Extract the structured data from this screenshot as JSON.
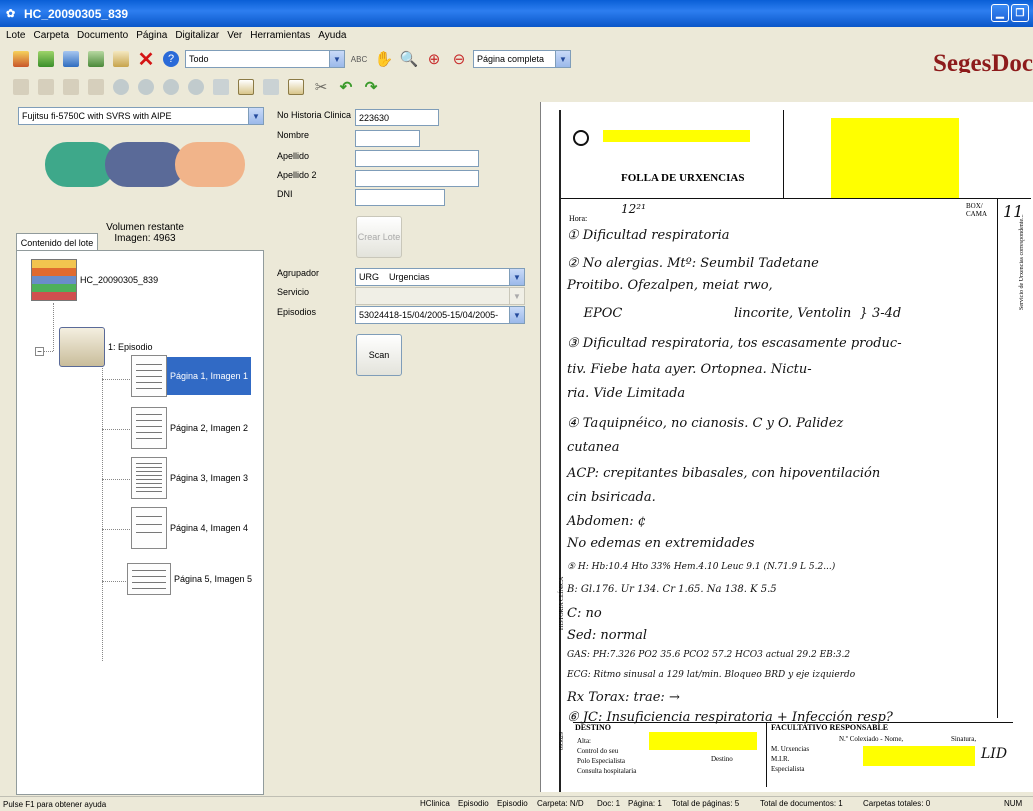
{
  "window": {
    "title": "HC_20090305_839"
  },
  "menu": [
    "Lote",
    "Carpeta",
    "Documento",
    "Página",
    "Digitalizar",
    "Ver",
    "Herramientas",
    "Ayuda"
  ],
  "toolbar": {
    "filter_value": "Todo",
    "zoom_value": "Página completa",
    "brand_main": "Seges",
    "brand_tail": "Doc"
  },
  "scanner": {
    "model": "Fujitsu fi-5750C with SVRS with AIPE",
    "volume_label": "Volumen restante",
    "images_label": "Imagen: 4963"
  },
  "tree": {
    "tab_label": "Contenido del lote",
    "root_label": "HC_20090305_839",
    "episode_label": "1: Episodio",
    "pages": [
      {
        "label": "Página 1, Imagen 1"
      },
      {
        "label": "Página 2, Imagen 2"
      },
      {
        "label": "Página 3, Imagen 3"
      },
      {
        "label": "Página 4, Imagen 4"
      },
      {
        "label": "Página 5, Imagen 5"
      }
    ]
  },
  "form": {
    "historia_label": "No Historia Clinica",
    "historia_value": "223630",
    "nombre_label": "Nombre",
    "apellido_label": "Apellido",
    "apellido2_label": "Apellido 2",
    "dni_label": "DNI",
    "crear_lote": "Crear Lote",
    "agrupador_label": "Agrupador",
    "agrupador_value": "URG    Urgencias",
    "servicio_label": "Servicio",
    "episodios_label": "Episodios",
    "episodios_value": "53024418-15/04/2005-15/04/2005-",
    "scan_button": "Scan"
  },
  "document": {
    "form_title": "FOLLA DE URXENCIAS",
    "hora_label": "Hora:",
    "hora_value": "12²¹",
    "box_label": "BOX/\nCAMA",
    "box_value": "11",
    "destino_label": "DESTINO",
    "facultativo_label": "FACULTATIVO RESPONSABLE",
    "colegiado_label": "N.º Colexiado - Nome,",
    "sinatura_label": "Sinatura,",
    "side_label": "HISTORIA CLÍNICA",
    "code_label": "095629",
    "side_note": "Servicio de Urxencias correspondente...",
    "lines": [
      "① Dificultad respiratoria",
      "② No alergias.    Mtº: Seumbil Tadetane",
      "    Proitibo.                      Ofezalpen, meiat rwo,",
      "    EPOC                           lincorite, Ventolin  } 3-4d",
      "③ Dificultad respiratoria, tos escasamente produc-",
      "    tiv. Fiebe hata ayer. Ortopnea. Nictu-",
      "    ria. Vide Limitada",
      "④ Taquipnéico, no cianosis. C y O. Palidez",
      "    cutanea",
      "    ACP: crepitantes bibasales, con hipoventilación",
      "    cin bsiricada.",
      "    Abdomen: ¢",
      "    No edemas en extremidades",
      "⑤ H: Hb:10.4  Hto 33%  Hem.4.10  Leuc 9.1 (N.71.9 L 5.2...)",
      "    B: Gl.176. Ur 134. Cr 1.65. Na 138. K 5.5",
      "    C: no",
      "    Sed: normal",
      "    GAS: PH:7.326  PO2 35.6  PCO2 57.2  HCO3 actual 29.2  EB:3.2",
      "    ECG: Ritmo sinusal a 129 lat/min. Bloqueo BRD y eje izquierdo",
      "    Rx Torax: trae: →",
      "⑥ JC: Insuficiencia respiratoria + Infección resp?"
    ],
    "destino_lines": [
      "Alta:",
      "Control do seu",
      "Polo Especialista",
      "Consulta hospitalaria"
    ],
    "destino_right": "Destino",
    "urgencias_lines": [
      "M. Urxencias",
      "M.I.R.",
      "Especialista"
    ]
  },
  "status": {
    "help": "Pulse F1 para obtener ayuda",
    "hclinica": "HClinica",
    "episodio1": "Episodio",
    "episodio2": "Episodio",
    "carpeta": "Carpeta: N/D",
    "doc": "Doc: 1",
    "pagina": "Página: 1",
    "total_paginas": "Total de páginas: 5",
    "total_docs": "Total de documentos: 1",
    "carpetas": "Carpetas totales: 0",
    "num": "NUM"
  }
}
